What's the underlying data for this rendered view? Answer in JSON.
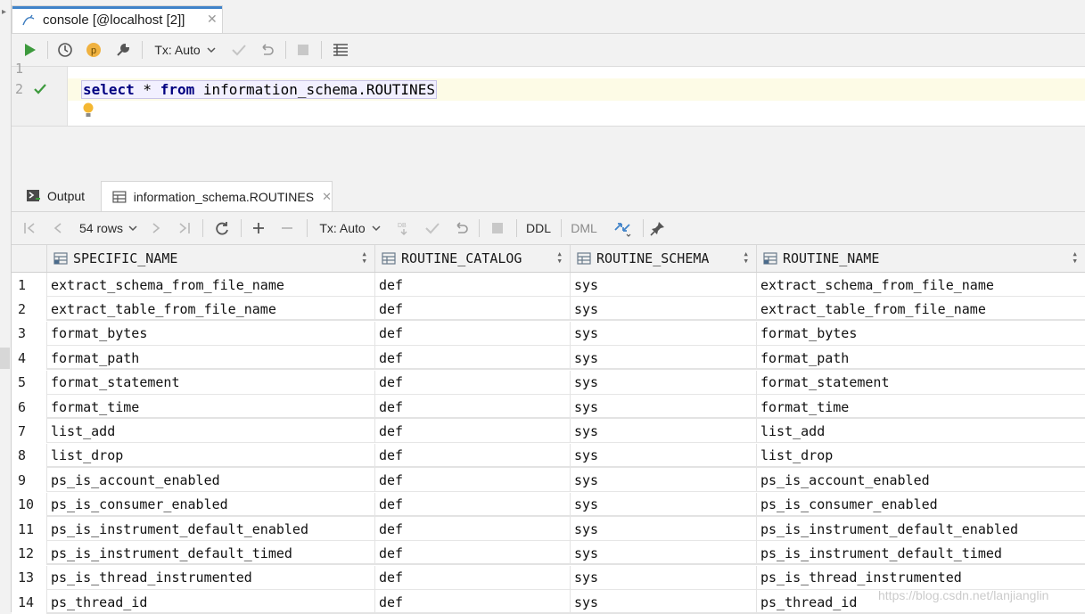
{
  "console_tab": {
    "title": "console [@localhost [2]]",
    "close": "✕"
  },
  "editor_toolbar": {
    "tx_mode": "Tx: Auto"
  },
  "editor": {
    "line_numbers": [
      "1",
      "2"
    ],
    "query_tokens": {
      "kw1": "select",
      "star": " * ",
      "kw2": "from",
      "schema": " information_schema.",
      "table": "ROUTINES"
    }
  },
  "result_tabs": [
    {
      "label": "Output"
    },
    {
      "label": "information_schema.ROUTINES",
      "close": "✕"
    }
  ],
  "result_toolbar": {
    "rows": "54 rows",
    "tx_mode": "Tx: Auto",
    "ddl": "DDL",
    "dml": "DML"
  },
  "grid": {
    "columns": [
      "SPECIFIC_NAME",
      "ROUTINE_CATALOG",
      "ROUTINE_SCHEMA",
      "ROUTINE_NAME"
    ],
    "rows": [
      [
        "1",
        "extract_schema_from_file_name",
        "def",
        "sys",
        "extract_schema_from_file_name"
      ],
      [
        "2",
        "extract_table_from_file_name",
        "def",
        "sys",
        "extract_table_from_file_name"
      ],
      [
        "3",
        "format_bytes",
        "def",
        "sys",
        "format_bytes"
      ],
      [
        "4",
        "format_path",
        "def",
        "sys",
        "format_path"
      ],
      [
        "5",
        "format_statement",
        "def",
        "sys",
        "format_statement"
      ],
      [
        "6",
        "format_time",
        "def",
        "sys",
        "format_time"
      ],
      [
        "7",
        "list_add",
        "def",
        "sys",
        "list_add"
      ],
      [
        "8",
        "list_drop",
        "def",
        "sys",
        "list_drop"
      ],
      [
        "9",
        "ps_is_account_enabled",
        "def",
        "sys",
        "ps_is_account_enabled"
      ],
      [
        "10",
        "ps_is_consumer_enabled",
        "def",
        "sys",
        "ps_is_consumer_enabled"
      ],
      [
        "11",
        "ps_is_instrument_default_enabled",
        "def",
        "sys",
        "ps_is_instrument_default_enabled"
      ],
      [
        "12",
        "ps_is_instrument_default_timed",
        "def",
        "sys",
        "ps_is_instrument_default_timed"
      ],
      [
        "13",
        "ps_is_thread_instrumented",
        "def",
        "sys",
        "ps_is_thread_instrumented"
      ],
      [
        "14",
        "ps_thread_id",
        "def",
        "sys",
        "ps_thread_id"
      ]
    ]
  },
  "watermark": "https://blog.csdn.net/lanjianglin",
  "colors": {
    "accent": "#4083c9",
    "keyword": "#000080",
    "run_green": "#3d9a3d",
    "selection_bg": "#f2f0ff"
  },
  "icons": [
    "mysql-icon",
    "run-icon",
    "history-icon",
    "profile-p-icon",
    "wrench-icon",
    "check-icon",
    "undo-icon",
    "stop-icon",
    "grid-icon",
    "checkmark-icon",
    "bulb-icon",
    "output-icon",
    "table-icon",
    "first-page-icon",
    "prev-icon",
    "next-icon",
    "last-page-icon",
    "refresh-icon",
    "add-icon",
    "remove-icon",
    "db-icon",
    "compare-icon",
    "pin-icon"
  ]
}
